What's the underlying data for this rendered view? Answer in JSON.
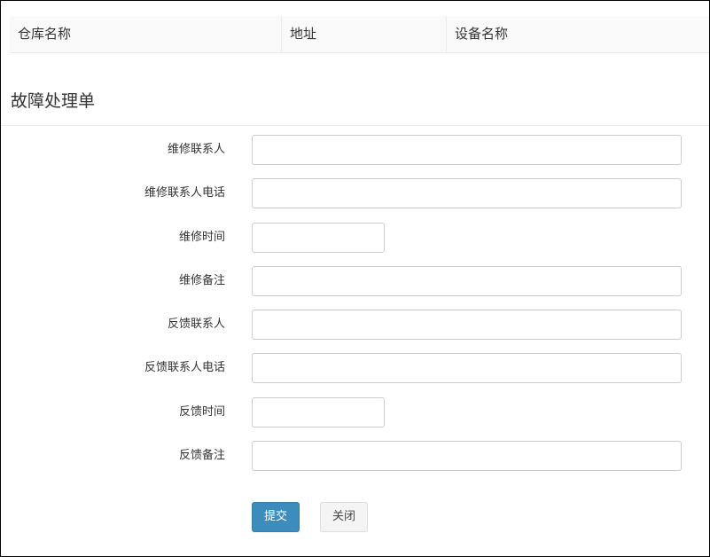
{
  "info_table": {
    "headers": [
      "仓库名称",
      "地址",
      "设备名称"
    ]
  },
  "section": {
    "title": "故障处理单"
  },
  "form": {
    "fields": [
      {
        "label": "维修联系人",
        "value": "",
        "width": "wide"
      },
      {
        "label": "维修联系人电话",
        "value": "",
        "width": "wide"
      },
      {
        "label": "维修时间",
        "value": "",
        "width": "short"
      },
      {
        "label": "维修备注",
        "value": "",
        "width": "wide"
      },
      {
        "label": "反馈联系人",
        "value": "",
        "width": "wide"
      },
      {
        "label": "反馈联系人电话",
        "value": "",
        "width": "wide"
      },
      {
        "label": "反馈时间",
        "value": "",
        "width": "short"
      },
      {
        "label": "反馈备注",
        "value": "",
        "width": "wide"
      }
    ]
  },
  "buttons": {
    "submit_label": "提交",
    "close_label": "关闭"
  },
  "colors": {
    "primary": "#3c8dbc",
    "default_button": "#f4f4f4",
    "table_header_bg": "#f9f9f9"
  }
}
